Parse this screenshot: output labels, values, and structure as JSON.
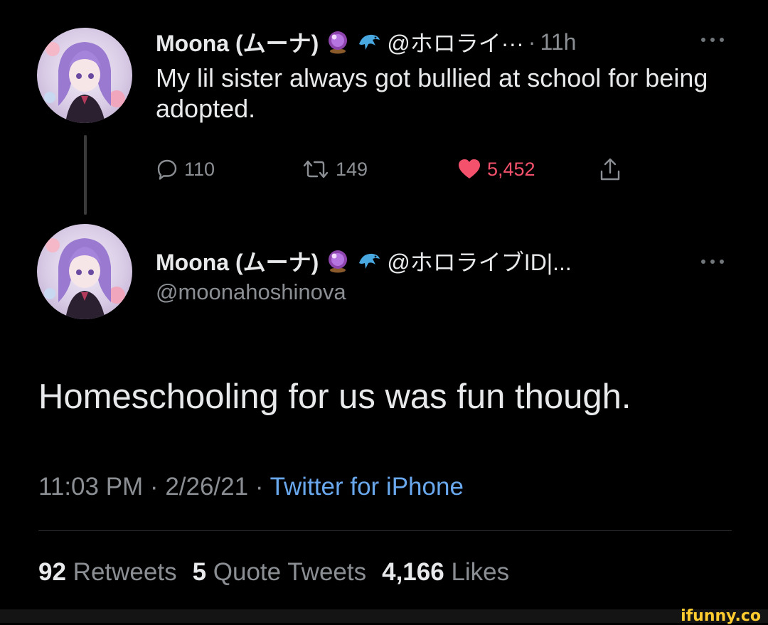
{
  "reply_tweet": {
    "display_name": "Moona (ムーナ)",
    "handle_truncated": "@ホロライ···",
    "time_sep": "·",
    "time": "11h",
    "text": "My lil sister always got bullied at school for being adopted.",
    "actions": {
      "replies": "110",
      "retweets": "149",
      "likes": "5,452"
    }
  },
  "main_tweet": {
    "display_name": "Moona (ムーナ)",
    "handle_truncated": "@ホロライブID|...",
    "handle": "@moonahoshinova",
    "text": "Homeschooling for us was fun though.",
    "timestamp": "11:03 PM · 2/26/21 · ",
    "source": "Twitter for iPhone",
    "stats": {
      "retweets_count": "92",
      "retweets_label": "Retweets",
      "quotes_count": "5",
      "quotes_label": "Quote Tweets",
      "likes_count": "4,166",
      "likes_label": "Likes"
    }
  },
  "icons": [
    "crystal-ball-icon",
    "dolphin-icon",
    "more-icon",
    "reply-icon",
    "retweet-icon",
    "heart-icon",
    "share-icon"
  ],
  "colors": {
    "background": "#000000",
    "text": "#e7e9ea",
    "muted": "#8b8f94",
    "link": "#6aa8ee",
    "like": "#f4516c",
    "watermark": "#ffcc2f"
  },
  "watermark": "ifunny.co"
}
